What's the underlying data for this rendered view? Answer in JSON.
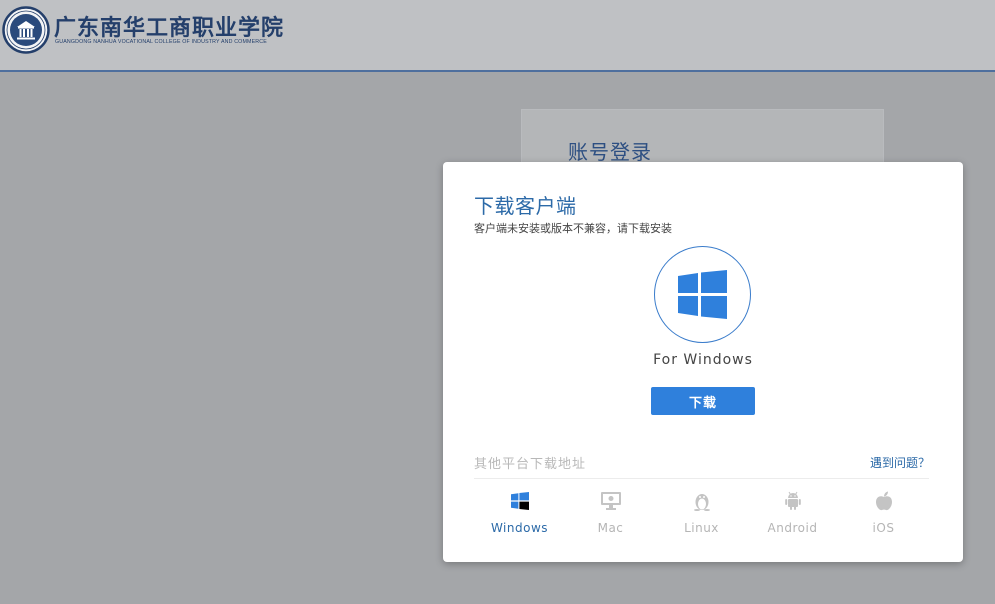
{
  "header": {
    "logo_name_cn": "广东南华工商职业学院",
    "logo_name_en": "GUANGDONG NANHUA VOCATIONAL COLLEGE OF INDUSTRY AND COMMERCE"
  },
  "login": {
    "title": "账号登录"
  },
  "modal": {
    "title": "下载客户端",
    "subtitle": "客户端未安装或版本不兼容，请下载安装",
    "platform_label": "For Windows",
    "download_label": "下载",
    "other_platforms_label": "其他平台下载地址",
    "help_link": "遇到问题？",
    "tabs": [
      {
        "label": "Windows",
        "icon": "windows-icon",
        "active": true
      },
      {
        "label": "Mac",
        "icon": "monitor-icon",
        "active": false
      },
      {
        "label": "Linux",
        "icon": "penguin-icon",
        "active": false
      },
      {
        "label": "Android",
        "icon": "android-icon",
        "active": false
      },
      {
        "label": "iOS",
        "icon": "apple-icon",
        "active": false
      }
    ]
  },
  "colors": {
    "accent": "#2f80dc",
    "header_text": "#243f6b",
    "link": "#2c6aa8",
    "inactive_tab": "#b5b5b5"
  }
}
